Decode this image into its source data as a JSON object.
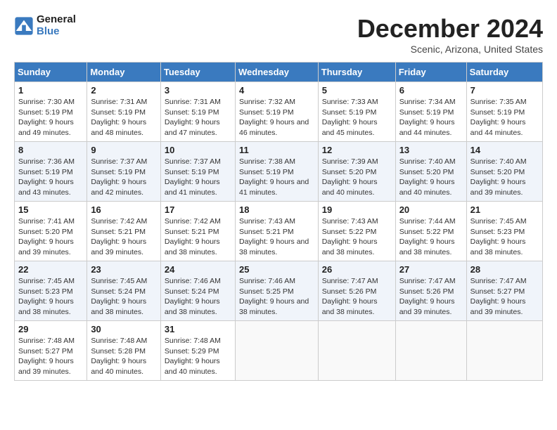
{
  "header": {
    "logo_line1": "General",
    "logo_line2": "Blue",
    "month": "December 2024",
    "location": "Scenic, Arizona, United States"
  },
  "days_of_week": [
    "Sunday",
    "Monday",
    "Tuesday",
    "Wednesday",
    "Thursday",
    "Friday",
    "Saturday"
  ],
  "weeks": [
    [
      {
        "day": "1",
        "sunrise": "7:30 AM",
        "sunset": "5:19 PM",
        "daylight": "9 hours and 49 minutes."
      },
      {
        "day": "2",
        "sunrise": "7:31 AM",
        "sunset": "5:19 PM",
        "daylight": "9 hours and 48 minutes."
      },
      {
        "day": "3",
        "sunrise": "7:31 AM",
        "sunset": "5:19 PM",
        "daylight": "9 hours and 47 minutes."
      },
      {
        "day": "4",
        "sunrise": "7:32 AM",
        "sunset": "5:19 PM",
        "daylight": "9 hours and 46 minutes."
      },
      {
        "day": "5",
        "sunrise": "7:33 AM",
        "sunset": "5:19 PM",
        "daylight": "9 hours and 45 minutes."
      },
      {
        "day": "6",
        "sunrise": "7:34 AM",
        "sunset": "5:19 PM",
        "daylight": "9 hours and 44 minutes."
      },
      {
        "day": "7",
        "sunrise": "7:35 AM",
        "sunset": "5:19 PM",
        "daylight": "9 hours and 44 minutes."
      }
    ],
    [
      {
        "day": "8",
        "sunrise": "7:36 AM",
        "sunset": "5:19 PM",
        "daylight": "9 hours and 43 minutes."
      },
      {
        "day": "9",
        "sunrise": "7:37 AM",
        "sunset": "5:19 PM",
        "daylight": "9 hours and 42 minutes."
      },
      {
        "day": "10",
        "sunrise": "7:37 AM",
        "sunset": "5:19 PM",
        "daylight": "9 hours and 41 minutes."
      },
      {
        "day": "11",
        "sunrise": "7:38 AM",
        "sunset": "5:19 PM",
        "daylight": "9 hours and 41 minutes."
      },
      {
        "day": "12",
        "sunrise": "7:39 AM",
        "sunset": "5:20 PM",
        "daylight": "9 hours and 40 minutes."
      },
      {
        "day": "13",
        "sunrise": "7:40 AM",
        "sunset": "5:20 PM",
        "daylight": "9 hours and 40 minutes."
      },
      {
        "day": "14",
        "sunrise": "7:40 AM",
        "sunset": "5:20 PM",
        "daylight": "9 hours and 39 minutes."
      }
    ],
    [
      {
        "day": "15",
        "sunrise": "7:41 AM",
        "sunset": "5:20 PM",
        "daylight": "9 hours and 39 minutes."
      },
      {
        "day": "16",
        "sunrise": "7:42 AM",
        "sunset": "5:21 PM",
        "daylight": "9 hours and 39 minutes."
      },
      {
        "day": "17",
        "sunrise": "7:42 AM",
        "sunset": "5:21 PM",
        "daylight": "9 hours and 38 minutes."
      },
      {
        "day": "18",
        "sunrise": "7:43 AM",
        "sunset": "5:21 PM",
        "daylight": "9 hours and 38 minutes."
      },
      {
        "day": "19",
        "sunrise": "7:43 AM",
        "sunset": "5:22 PM",
        "daylight": "9 hours and 38 minutes."
      },
      {
        "day": "20",
        "sunrise": "7:44 AM",
        "sunset": "5:22 PM",
        "daylight": "9 hours and 38 minutes."
      },
      {
        "day": "21",
        "sunrise": "7:45 AM",
        "sunset": "5:23 PM",
        "daylight": "9 hours and 38 minutes."
      }
    ],
    [
      {
        "day": "22",
        "sunrise": "7:45 AM",
        "sunset": "5:23 PM",
        "daylight": "9 hours and 38 minutes."
      },
      {
        "day": "23",
        "sunrise": "7:45 AM",
        "sunset": "5:24 PM",
        "daylight": "9 hours and 38 minutes."
      },
      {
        "day": "24",
        "sunrise": "7:46 AM",
        "sunset": "5:24 PM",
        "daylight": "9 hours and 38 minutes."
      },
      {
        "day": "25",
        "sunrise": "7:46 AM",
        "sunset": "5:25 PM",
        "daylight": "9 hours and 38 minutes."
      },
      {
        "day": "26",
        "sunrise": "7:47 AM",
        "sunset": "5:26 PM",
        "daylight": "9 hours and 38 minutes."
      },
      {
        "day": "27",
        "sunrise": "7:47 AM",
        "sunset": "5:26 PM",
        "daylight": "9 hours and 39 minutes."
      },
      {
        "day": "28",
        "sunrise": "7:47 AM",
        "sunset": "5:27 PM",
        "daylight": "9 hours and 39 minutes."
      }
    ],
    [
      {
        "day": "29",
        "sunrise": "7:48 AM",
        "sunset": "5:27 PM",
        "daylight": "9 hours and 39 minutes."
      },
      {
        "day": "30",
        "sunrise": "7:48 AM",
        "sunset": "5:28 PM",
        "daylight": "9 hours and 40 minutes."
      },
      {
        "day": "31",
        "sunrise": "7:48 AM",
        "sunset": "5:29 PM",
        "daylight": "9 hours and 40 minutes."
      },
      null,
      null,
      null,
      null
    ]
  ]
}
